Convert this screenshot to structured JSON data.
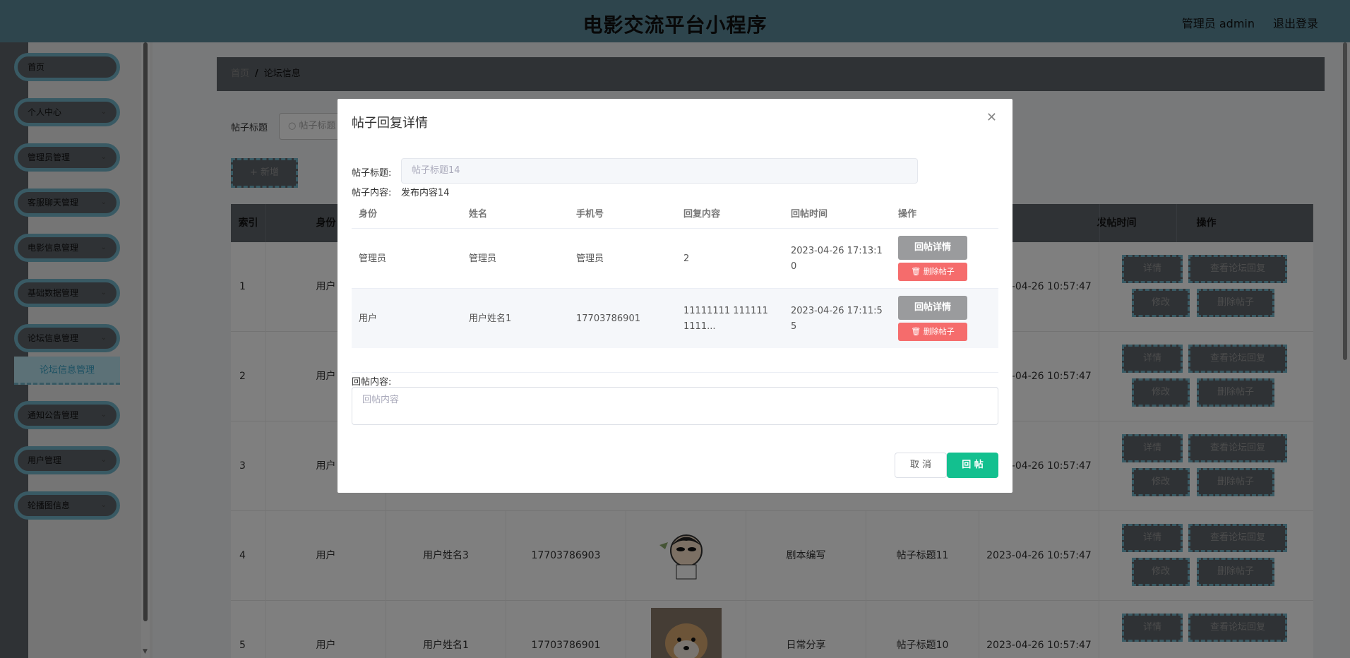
{
  "header": {
    "title": "电影交流平台小程序",
    "admin_label": "管理员 admin",
    "logout_label": "退出登录"
  },
  "sidebar": {
    "items": [
      {
        "label": "首页"
      },
      {
        "label": "个人中心"
      },
      {
        "label": "管理员管理"
      },
      {
        "label": "客服聊天管理"
      },
      {
        "label": "电影信息管理"
      },
      {
        "label": "基础数据管理"
      },
      {
        "label": "论坛信息管理"
      },
      {
        "label": "通知公告管理"
      },
      {
        "label": "用户管理"
      },
      {
        "label": "轮播图信息"
      }
    ],
    "active_sub": "论坛信息管理"
  },
  "breadcrumb": {
    "home": "首页",
    "separator": "/",
    "current": "论坛信息"
  },
  "search": {
    "label": "帖子标题",
    "placeholder": "帖子标题"
  },
  "toolbar": {
    "add_label": "+ 新增"
  },
  "table": {
    "headers": [
      "索引",
      "身份",
      "",
      "",
      "",
      "",
      "",
      "发帖时间",
      "操作"
    ],
    "rows": [
      {
        "index": "1",
        "identity": "用户",
        "name": "",
        "phone": "",
        "content_type": "",
        "title": "",
        "time": "2023-04-26 10:57:47"
      },
      {
        "index": "2",
        "identity": "用户",
        "name": "",
        "phone": "",
        "content_type": "",
        "title": "",
        "time": "2023-04-26 10:57:47"
      },
      {
        "index": "3",
        "identity": "用户",
        "name": "",
        "phone": "",
        "content_type": "",
        "title": "",
        "time": "2023-04-26 10:57:47"
      },
      {
        "index": "4",
        "identity": "用户",
        "name": "用户姓名3",
        "phone": "17703786903",
        "content_type": "剧本编写",
        "title": "帖子标题11",
        "time": "2023-04-26 10:57:47"
      },
      {
        "index": "5",
        "identity": "用户",
        "name": "用户姓名1",
        "phone": "17703786901",
        "content_type": "日常分享",
        "title": "帖子标题10",
        "time": "2023-04-26 10:57:47"
      }
    ],
    "ops": {
      "detail": "详情",
      "view_reply": "查看论坛回复",
      "edit": "修改",
      "delete": "删除帖子"
    }
  },
  "modal": {
    "title": "帖子回复详情",
    "post_title_label": "帖子标题:",
    "post_title_value": "帖子标题14",
    "post_content_label": "帖子内容:",
    "post_content_value": "发布内容14",
    "reply_headers": [
      "身份",
      "姓名",
      "手机号",
      "回复内容",
      "回帖时间",
      "操作"
    ],
    "replies": [
      {
        "identity": "管理员",
        "name": "管理员",
        "phone": "管理员",
        "content": "2",
        "time": "2023-04-26 17:13:10"
      },
      {
        "identity": "用户",
        "name": "用户姓名1",
        "phone": "17703786901",
        "content": "11111111 111111 1111...",
        "time": "2023-04-26 17:11:55"
      }
    ],
    "reply_detail_label": "回帖详情",
    "reply_delete_label": "删除帖子",
    "reply_content_label": "回帖内容:",
    "reply_placeholder": "回帖内容",
    "cancel_label": "取 消",
    "submit_label": "回 帖"
  },
  "colors": {
    "header_bg": "#5c8a9b",
    "dark_gray": "#5e646b",
    "accent_blue": "#73b5c8",
    "submit_green": "#13c08f",
    "delete_red": "#f56c6c"
  }
}
